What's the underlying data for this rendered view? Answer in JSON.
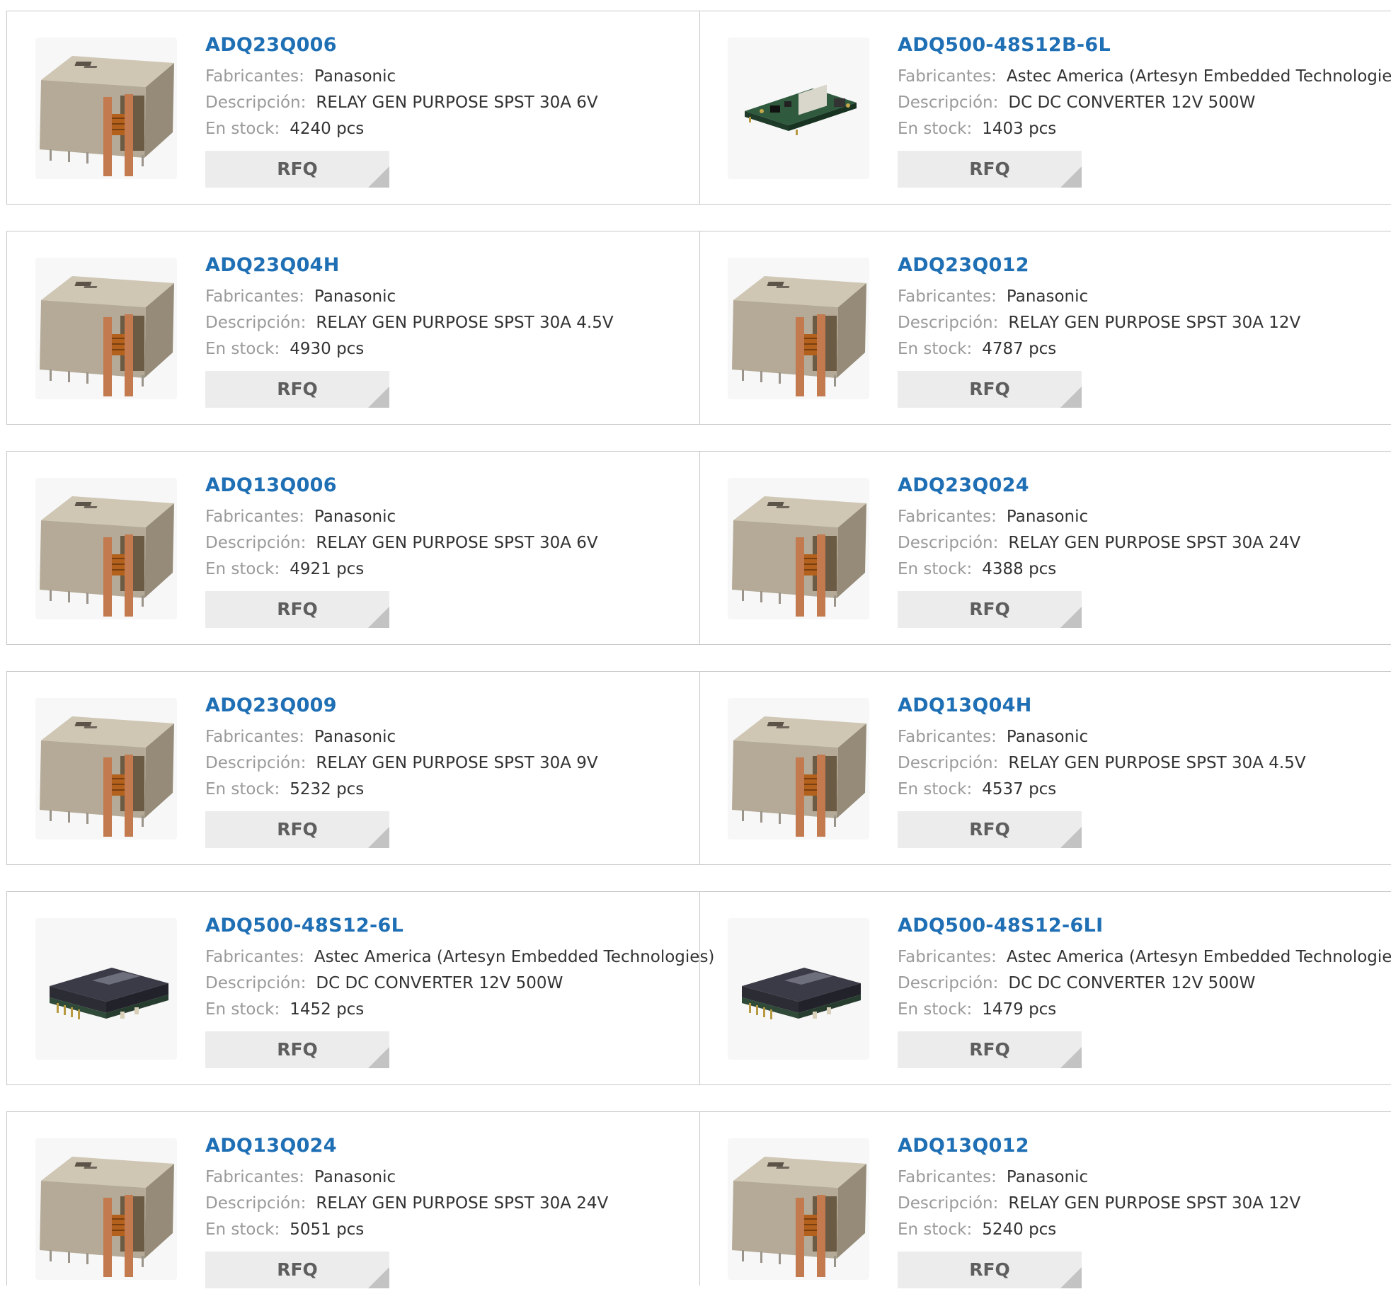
{
  "labels": {
    "manufacturer": "Fabricantes:",
    "description": "Descripción:",
    "stock": "En stock:",
    "rfq": "RFQ"
  },
  "colors": {
    "part_link": "#1f6fb5",
    "label": "#9a9a9a",
    "value": "#333333",
    "button_bg": "#ececec",
    "border": "#c8c8c8"
  },
  "products": [
    {
      "part": "ADQ23Q006",
      "manufacturer": "Panasonic",
      "description": "RELAY GEN PURPOSE SPST 30A 6V",
      "stock": "4240 pcs",
      "image": "relay-image"
    },
    {
      "part": "ADQ500-48S12B-6L",
      "manufacturer": "Astec America (Artesyn Embedded Technologies)",
      "description": "DC DC CONVERTER 12V 500W",
      "stock": "1403 pcs",
      "image": "pcb-converter-image"
    },
    {
      "part": "ADQ23Q04H",
      "manufacturer": "Panasonic",
      "description": "RELAY GEN PURPOSE SPST 30A 4.5V",
      "stock": "4930 pcs",
      "image": "relay-image"
    },
    {
      "part": "ADQ23Q012",
      "manufacturer": "Panasonic",
      "description": "RELAY GEN PURPOSE SPST 30A 12V",
      "stock": "4787 pcs",
      "image": "relay-image"
    },
    {
      "part": "ADQ13Q006",
      "manufacturer": "Panasonic",
      "description": "RELAY GEN PURPOSE SPST 30A 6V",
      "stock": "4921 pcs",
      "image": "relay-image"
    },
    {
      "part": "ADQ23Q024",
      "manufacturer": "Panasonic",
      "description": "RELAY GEN PURPOSE SPST 30A 24V",
      "stock": "4388 pcs",
      "image": "relay-image"
    },
    {
      "part": "ADQ23Q009",
      "manufacturer": "Panasonic",
      "description": "RELAY GEN PURPOSE SPST 30A 9V",
      "stock": "5232 pcs",
      "image": "relay-image"
    },
    {
      "part": "ADQ13Q04H",
      "manufacturer": "Panasonic",
      "description": "RELAY GEN PURPOSE SPST 30A 4.5V",
      "stock": "4537 pcs",
      "image": "relay-image"
    },
    {
      "part": "ADQ500-48S12-6L",
      "manufacturer": "Astec America (Artesyn Embedded Technologies)",
      "description": "DC DC CONVERTER 12V 500W",
      "stock": "1452 pcs",
      "image": "dc-converter-image"
    },
    {
      "part": "ADQ500-48S12-6LI",
      "manufacturer": "Astec America (Artesyn Embedded Technologies)",
      "description": "DC DC CONVERTER 12V 500W",
      "stock": "1479 pcs",
      "image": "dc-converter-image"
    },
    {
      "part": "ADQ13Q024",
      "manufacturer": "Panasonic",
      "description": "RELAY GEN PURPOSE SPST 30A 24V",
      "stock": "5051 pcs",
      "image": "relay-image"
    },
    {
      "part": "ADQ13Q012",
      "manufacturer": "Panasonic",
      "description": "RELAY GEN PURPOSE SPST 30A 12V",
      "stock": "5240 pcs",
      "image": "relay-image"
    }
  ]
}
